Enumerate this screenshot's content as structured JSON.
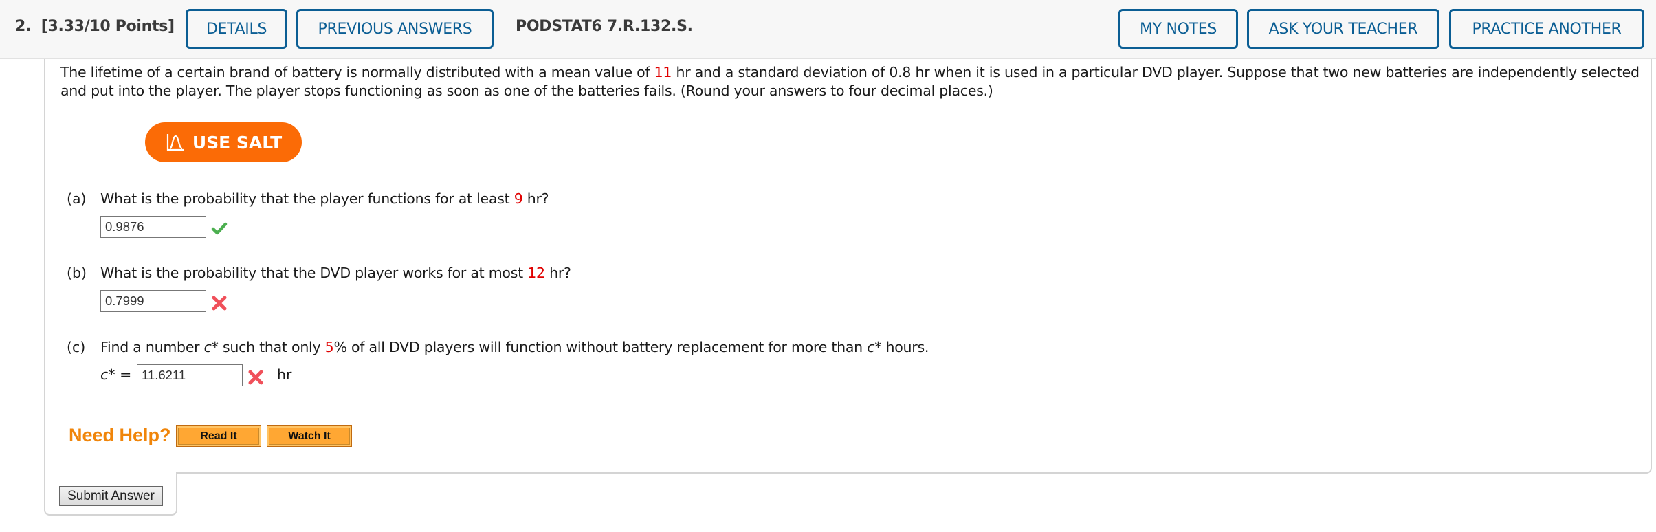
{
  "header": {
    "question_number": "2.",
    "points": "[3.33/10 Points]",
    "buttons": {
      "details": "DETAILS",
      "previous_answers": "PREVIOUS ANSWERS",
      "my_notes": "MY NOTES",
      "ask_teacher": "ASK YOUR TEACHER",
      "practice_another": "PRACTICE ANOTHER"
    },
    "question_code": "PODSTAT6 7.R.132.S."
  },
  "problem": {
    "text_1": "The lifetime of a certain brand of battery is normally distributed with a mean value of ",
    "mean": "11",
    "text_2": " hr and a standard deviation of 0.8 hr when it is used in a particular DVD player. Suppose that two new batteries are independently selected and put into the player. The player stops functioning as soon as one of the batteries fails. (Round your answers to four decimal places.)"
  },
  "salt_button": {
    "label": "USE SALT",
    "icon": "salt-curve-icon"
  },
  "parts": [
    {
      "letter": "(a)",
      "q1": "What is the probability that the player functions for at least ",
      "highlight": "9",
      "q2": " hr?",
      "answer": "0.9876",
      "status": "correct"
    },
    {
      "letter": "(b)",
      "q1": "What is the probability that the DVD player works for at most ",
      "highlight": "12",
      "q2": " hr?",
      "answer": "0.7999",
      "status": "incorrect"
    },
    {
      "letter": "(c)",
      "q1": "Find a number ",
      "var1": "c*",
      "q1b": " such that only ",
      "highlight": "5",
      "q2": "% of all DVD players will function without battery replacement for more than ",
      "var2": "c*",
      "q3": " hours.",
      "answer_label": "c*",
      "equals": "=",
      "answer": "11.6211",
      "unit": "hr",
      "status": "incorrect"
    }
  ],
  "help": {
    "label": "Need Help?",
    "read_it": "Read It",
    "watch_it": "Watch It"
  },
  "submit": {
    "label": "Submit Answer"
  },
  "colors": {
    "accent_blue": "#0b5e94",
    "salt_orange": "#fb6b06",
    "highlight_red": "#e00000",
    "help_orange": "#f0850a",
    "correct_green": "#4caf50",
    "incorrect_red": "#f0505a"
  }
}
